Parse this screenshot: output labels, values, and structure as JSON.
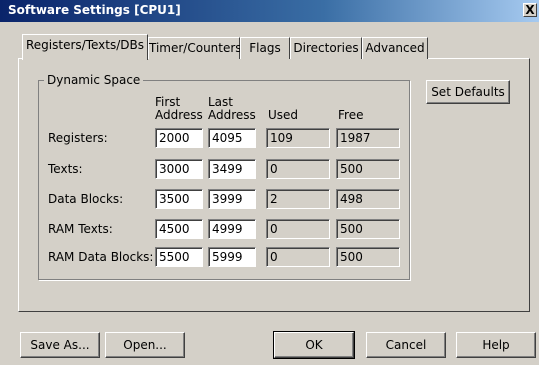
{
  "window": {
    "title": "Software Settings [CPU1]",
    "close_label": "X"
  },
  "tabs": [
    {
      "label": "Registers/Texts/DBs",
      "active": true
    },
    {
      "label": "Timer/Counters",
      "active": false
    },
    {
      "label": "Flags",
      "active": false
    },
    {
      "label": "Directories",
      "active": false
    },
    {
      "label": "Advanced",
      "active": false
    }
  ],
  "dynamic_space": {
    "label": "Dynamic Space",
    "columns": {
      "first_line1": "First",
      "first_line2": "Address",
      "last_line1": "Last",
      "last_line2": "Address",
      "used": "Used",
      "free": "Free"
    },
    "rows": [
      {
        "label": "Registers:",
        "first": "2000",
        "last": "4095",
        "used": "109",
        "free": "1987"
      },
      {
        "label": "Texts:",
        "first": "3000",
        "last": "3499",
        "used": "0",
        "free": "500"
      },
      {
        "label": "Data Blocks:",
        "first": "3500",
        "last": "3999",
        "used": "2",
        "free": "498"
      },
      {
        "label": "RAM Texts:",
        "first": "4500",
        "last": "4999",
        "used": "0",
        "free": "500"
      },
      {
        "label": "RAM Data Blocks:",
        "first": "5500",
        "last": "5999",
        "used": "0",
        "free": "500"
      }
    ]
  },
  "set_defaults_label": "Set Defaults",
  "footer": {
    "save_as": "Save As...",
    "open": "Open...",
    "ok": "OK",
    "cancel": "Cancel",
    "help": "Help"
  }
}
